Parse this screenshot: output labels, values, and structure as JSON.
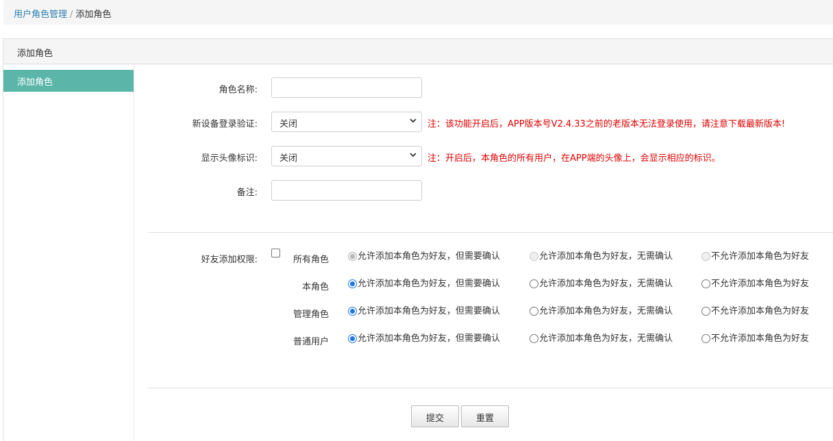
{
  "breadcrumb": {
    "parent": "用户角色管理",
    "separator": "/",
    "current": "添加角色"
  },
  "panel": {
    "heading": "添加角色"
  },
  "sidebar": {
    "items": [
      {
        "label": "添加角色",
        "active": true
      }
    ]
  },
  "form": {
    "role_name": {
      "label": "角色名称:",
      "value": ""
    },
    "device_verify": {
      "label": "新设备登录验证:",
      "value": "关闭",
      "note": "注：该功能开启后，APP版本号V2.4.33之前的老版本无法登录使用，请注意下载最新版本!"
    },
    "avatar_mark": {
      "label": "显示头像标识:",
      "value": "关闭",
      "note": "注：开启后，本角色的所有用户，在APP端的头像上，会显示相应的标识。"
    },
    "remark": {
      "label": "备注:",
      "value": ""
    }
  },
  "friend_permission": {
    "label": "好友添加权限:",
    "all_roles_checked": false,
    "options": [
      "允许添加本角色为好友，但需要确认",
      "允许添加本角色为好友，无需确认",
      "不允许添加本角色为好友"
    ],
    "rows": [
      {
        "label": "所有角色",
        "selected": 0,
        "disabled": true
      },
      {
        "label": "本角色",
        "selected": 0,
        "disabled": false
      },
      {
        "label": "管理角色",
        "selected": 0,
        "disabled": false
      },
      {
        "label": "普通用户",
        "selected": 0,
        "disabled": false
      }
    ]
  },
  "actions": {
    "submit": "提交",
    "reset": "重置"
  },
  "colors": {
    "accent": "#5bb5a9",
    "note": "#e00000",
    "link": "#2a7fb0",
    "radio": "#1a73e8"
  }
}
